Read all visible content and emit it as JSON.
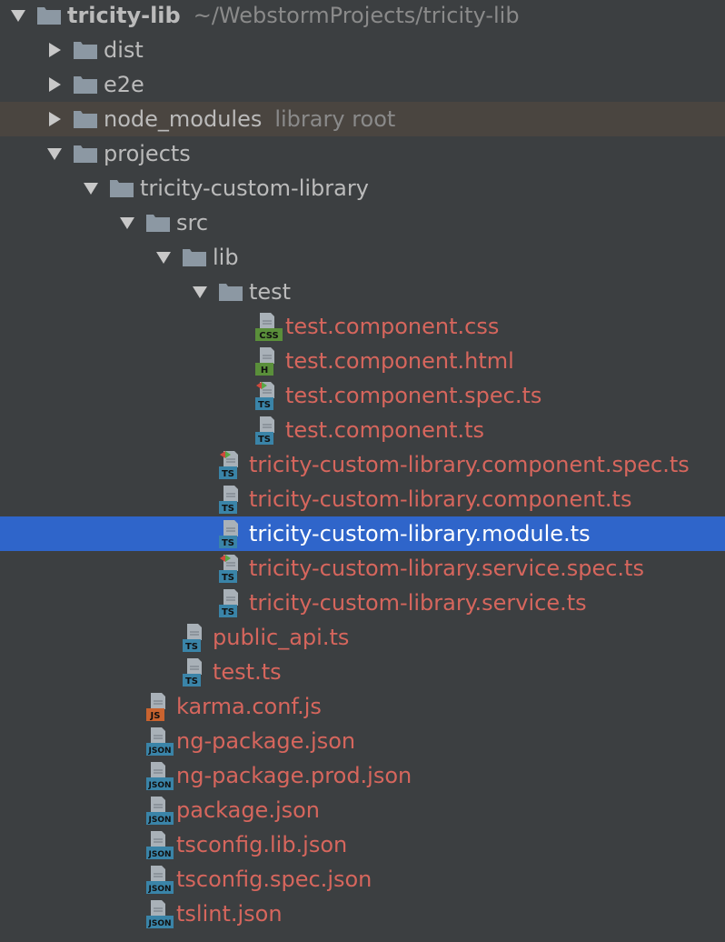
{
  "colors": {
    "background": "#3c3f41",
    "folder": "#8c98a3",
    "modified_file_text": "#d6665d",
    "folder_text": "#bbbbbb",
    "hint_text": "#8a8a8a",
    "selection": "#2f65ca",
    "excluded_row": "#4a4540",
    "ts_badge": "#3a84a8",
    "json_badge": "#3a84a8",
    "css_badge": "#5a8f3a",
    "html_badge": "#5a8f3a",
    "js_badge": "#c9632f"
  },
  "tree": [
    {
      "label": "tricity-lib",
      "hint": "~/WebstormProjects/tricity-lib",
      "type": "folder",
      "depth": 0,
      "expanded": true,
      "root": true
    },
    {
      "label": "dist",
      "type": "folder",
      "depth": 1,
      "expanded": false
    },
    {
      "label": "e2e",
      "type": "folder",
      "depth": 1,
      "expanded": false
    },
    {
      "label": "node_modules",
      "hint": "library root",
      "type": "folder",
      "depth": 1,
      "expanded": false,
      "excluded": true
    },
    {
      "label": "projects",
      "type": "folder",
      "depth": 1,
      "expanded": true
    },
    {
      "label": "tricity-custom-library",
      "type": "folder",
      "depth": 2,
      "expanded": true
    },
    {
      "label": "src",
      "type": "folder",
      "depth": 3,
      "expanded": true
    },
    {
      "label": "lib",
      "type": "folder",
      "depth": 4,
      "expanded": true
    },
    {
      "label": "test",
      "type": "folder",
      "depth": 5,
      "expanded": true
    },
    {
      "label": "test.component.css",
      "type": "file",
      "badge": "CSS",
      "icon": "css-file-icon",
      "depth": 6
    },
    {
      "label": "test.component.html",
      "type": "file",
      "badge": "H",
      "icon": "html-file-icon",
      "depth": 6
    },
    {
      "label": "test.component.spec.ts",
      "type": "file",
      "badge": "TS",
      "icon": "ts-spec-file-icon",
      "spec": true,
      "depth": 6
    },
    {
      "label": "test.component.ts",
      "type": "file",
      "badge": "TS",
      "icon": "ts-file-icon",
      "depth": 6
    },
    {
      "label": "tricity-custom-library.component.spec.ts",
      "type": "file",
      "badge": "TS",
      "icon": "ts-spec-file-icon",
      "spec": true,
      "depth": 5
    },
    {
      "label": "tricity-custom-library.component.ts",
      "type": "file",
      "badge": "TS",
      "icon": "ts-file-icon",
      "depth": 5
    },
    {
      "label": "tricity-custom-library.module.ts",
      "type": "file",
      "badge": "TS",
      "icon": "ts-file-icon",
      "depth": 5,
      "selected": true
    },
    {
      "label": "tricity-custom-library.service.spec.ts",
      "type": "file",
      "badge": "TS",
      "icon": "ts-spec-file-icon",
      "spec": true,
      "depth": 5
    },
    {
      "label": "tricity-custom-library.service.ts",
      "type": "file",
      "badge": "TS",
      "icon": "ts-file-icon",
      "depth": 5
    },
    {
      "label": "public_api.ts",
      "type": "file",
      "badge": "TS",
      "icon": "ts-file-icon",
      "depth": 4
    },
    {
      "label": "test.ts",
      "type": "file",
      "badge": "TS",
      "icon": "ts-file-icon",
      "depth": 4
    },
    {
      "label": "karma.conf.js",
      "type": "file",
      "badge": "JS",
      "icon": "js-file-icon",
      "depth": 3
    },
    {
      "label": "ng-package.json",
      "type": "file",
      "badge": "JSON",
      "icon": "json-file-icon",
      "depth": 3
    },
    {
      "label": "ng-package.prod.json",
      "type": "file",
      "badge": "JSON",
      "icon": "json-file-icon",
      "depth": 3
    },
    {
      "label": "package.json",
      "type": "file",
      "badge": "JSON",
      "icon": "json-file-icon",
      "depth": 3
    },
    {
      "label": "tsconfig.lib.json",
      "type": "file",
      "badge": "JSON",
      "icon": "json-file-icon",
      "depth": 3
    },
    {
      "label": "tsconfig.spec.json",
      "type": "file",
      "badge": "JSON",
      "icon": "json-file-icon",
      "depth": 3
    },
    {
      "label": "tslint.json",
      "type": "file",
      "badge": "JSON",
      "icon": "json-file-icon",
      "depth": 3
    }
  ]
}
